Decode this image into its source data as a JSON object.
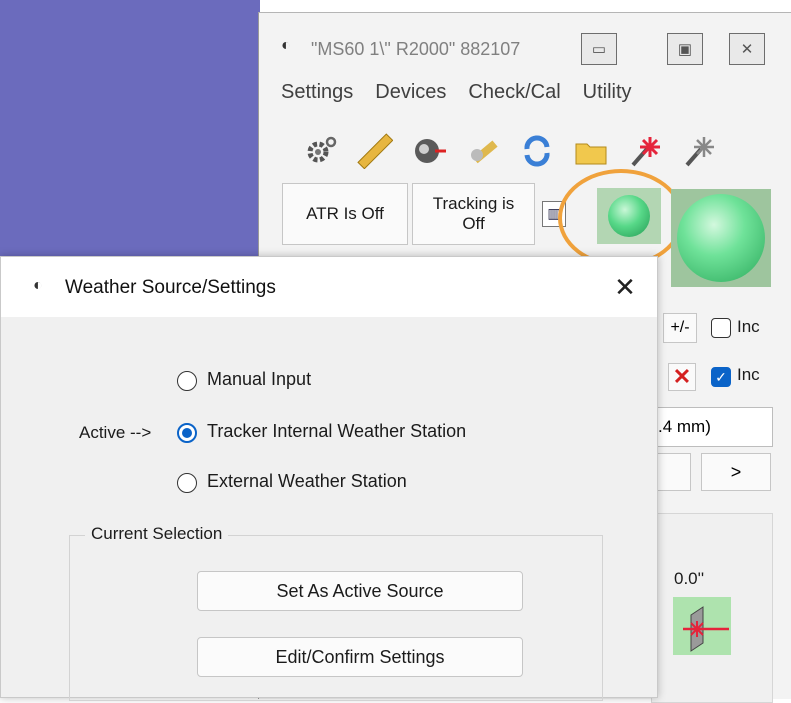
{
  "main_window": {
    "title": "\"MS60 1\\\" R2000\" 882107",
    "controls": {
      "minimize": "▭",
      "maximize": "▣",
      "close": "✕"
    },
    "menu": [
      "Settings",
      "Devices",
      "Check/Cal",
      "Utility"
    ],
    "toolbar_icons": [
      "gear-icon",
      "ruler-icon",
      "tracker-head-icon",
      "probe-icon",
      "refresh-icon",
      "folder-icon",
      "laser-red-icon",
      "laser-white-icon"
    ],
    "atr_button": "ATR Is Off",
    "tracking_button": {
      "line1": "Tracking is",
      "line2": "Off"
    },
    "pm_button": "+/-",
    "inc_label_1": "Inc",
    "inc_label_2": "Inc",
    "inc_checked_1": false,
    "inc_checked_2": true,
    "mm_value": ".4 mm)",
    "next_button": ">",
    "angle_value": "0.0''",
    "accent_color": "#f0a23c"
  },
  "dialog": {
    "title": "Weather Source/Settings",
    "close": "✕",
    "active_marker": "Active -->",
    "options": [
      {
        "label": "Manual Input",
        "selected": false
      },
      {
        "label": "Tracker Internal Weather Station",
        "selected": true
      },
      {
        "label": "External Weather Station",
        "selected": false
      }
    ],
    "group_label": "Current Selection",
    "set_active_button": "Set As Active Source",
    "edit_button": "Edit/Confirm Settings"
  }
}
